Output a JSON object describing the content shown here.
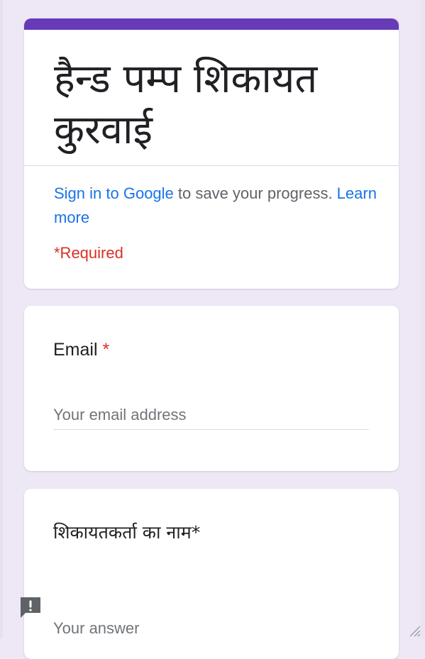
{
  "form": {
    "title": "हैन्ड पम्प शिकायत कुरवाई",
    "signin": {
      "link_text": "Sign in to Google",
      "message": " to save your progress. ",
      "learn_more": "Learn more"
    },
    "required_note": "*Required",
    "accent_color": "#673ab7"
  },
  "questions": {
    "email": {
      "label": "Email",
      "required_mark": "*",
      "placeholder": "Your email address"
    },
    "complainant_name": {
      "label": "शिकायतकर्ता का नाम*",
      "placeholder": "Your answer"
    }
  },
  "icons": {
    "feedback": "report-feedback-icon",
    "resize": "resize-handle-icon"
  }
}
